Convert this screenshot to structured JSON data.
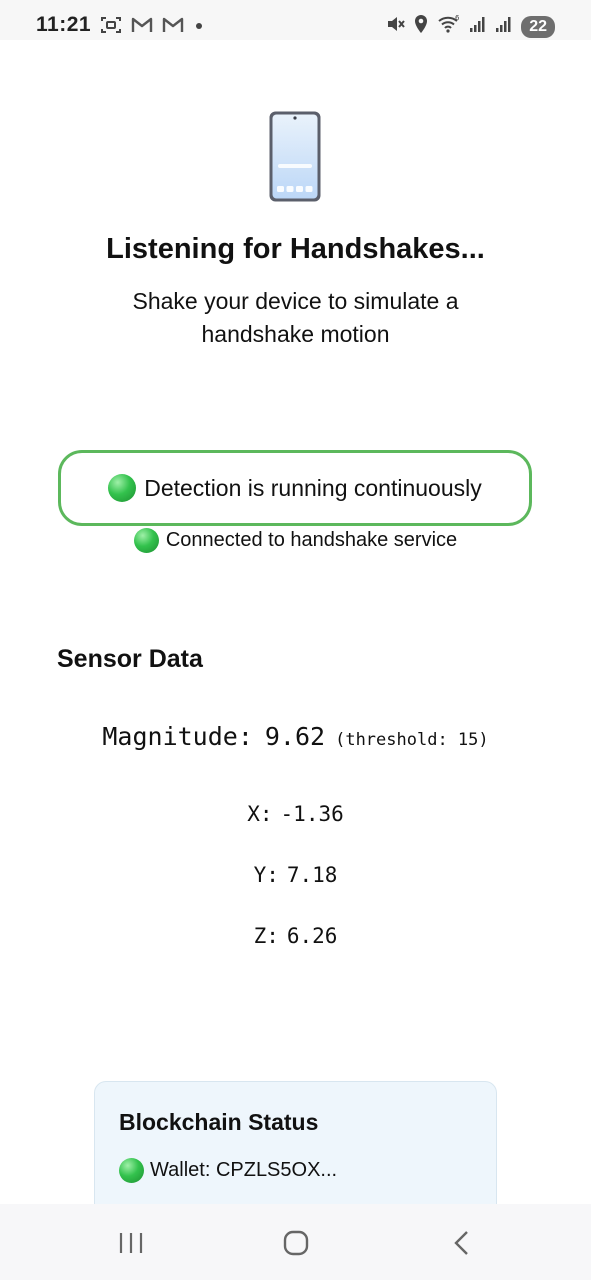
{
  "status_bar": {
    "time": "11:21",
    "battery": "22",
    "left_icons": [
      "screenshot-icon",
      "gmail-icon",
      "gmail-icon",
      "dot-icon"
    ],
    "right_icons": [
      "mute-icon",
      "location-icon",
      "wifi-icon",
      "signal-icon",
      "signal-icon"
    ]
  },
  "hero": {
    "icon": "mobile-phone-icon",
    "title": "Listening for Handshakes...",
    "subtitle": "Shake your device to simulate a handshake motion"
  },
  "status": {
    "detection": "Detection is running continuously",
    "connection": "Connected to handshake service",
    "indicator_color": "#33c24d",
    "pill_border_color": "#5cb85c"
  },
  "sensor": {
    "section_title": "Sensor Data",
    "magnitude_label": "Magnitude:",
    "magnitude_value": "9.62",
    "threshold": "(threshold: 15)",
    "x_label": "X:",
    "x_value": "-1.36",
    "y_label": "Y:",
    "y_value": "7.18",
    "z_label": "Z:",
    "z_value": "6.26"
  },
  "blockchain": {
    "title": "Blockchain Status",
    "wallet": "Wallet: CPZLS5OX...",
    "card_color": "#eef6fc"
  },
  "nav_bar": {
    "buttons": [
      "recents-icon",
      "home-icon",
      "back-icon"
    ]
  }
}
